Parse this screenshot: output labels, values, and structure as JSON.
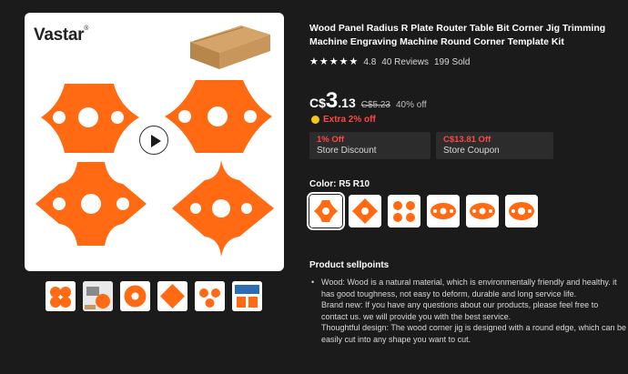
{
  "product": {
    "brand": "Vastar",
    "title": "Wood Panel Radius R Plate Router Table Bit Corner Jig Trimming Machine Engraving Machine Round Corner Template Kit",
    "rating": "4.8",
    "reviews": "40 Reviews",
    "sold": "199 Sold",
    "stars": 5
  },
  "price": {
    "currency": "C$",
    "integer": "3",
    "decimal": ".13",
    "original": "C$5.23",
    "discount": "40% off",
    "extra": "Extra 2% off"
  },
  "coupons": [
    {
      "top": "1% Off",
      "bottom": "Store Discount"
    },
    {
      "top": "C$13.81 Off",
      "bottom": "Store Coupon"
    }
  ],
  "color": {
    "label": "Color: R5 R10",
    "variants_count": 6
  },
  "sellpoints": {
    "heading": "Product sellpoints",
    "lines": [
      "Wood: Wood is a natural material, which is environmentally friendly and healthy. it",
      "has good toughness, not easy to deform, durable and long service life.",
      "Brand new: If you have any questions about our products, please feel free to",
      "contact us. we will provide you with the best service.",
      "Thoughtful design: The wood corner jig is designed with a round edge, which can be",
      "easily cut into any shape you want to cut."
    ]
  },
  "colors": {
    "background": "#1b1b1b",
    "accent_red": "#ff4747",
    "plate_orange": "#ff6a13"
  },
  "icons": [
    "play-icon",
    "star-icon",
    "coin-icon"
  ]
}
